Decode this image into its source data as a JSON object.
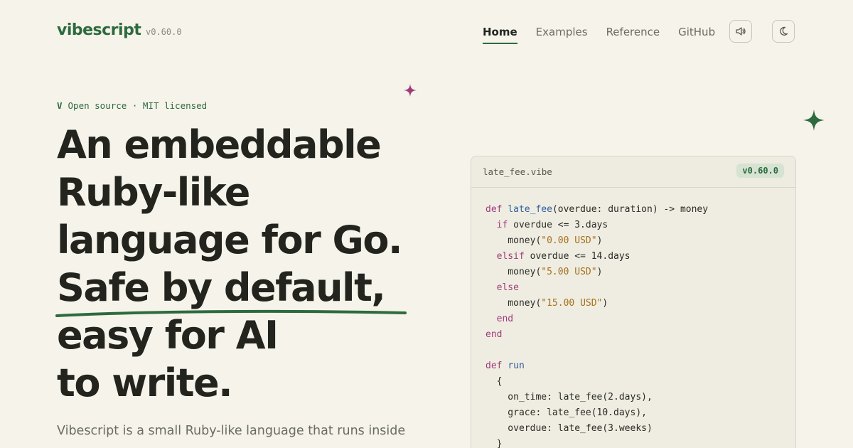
{
  "header": {
    "logo": "vibescript",
    "version": "v0.60.0",
    "nav": [
      {
        "label": "Home",
        "active": true
      },
      {
        "label": "Examples",
        "active": false
      },
      {
        "label": "Reference",
        "active": false
      },
      {
        "label": "GitHub",
        "active": false
      }
    ],
    "sound_icon": "speaker-icon",
    "theme_icon": "moon-icon"
  },
  "hero": {
    "eyebrow_mark": "V",
    "eyebrow_text": "Open source · MIT licensed",
    "headline": [
      "An embeddable",
      "Ruby-like",
      "language for Go.",
      "Safe by default,",
      "easy for AI",
      "to write."
    ],
    "lead": "Vibescript is a small Ruby-like language that runs inside"
  },
  "code_card": {
    "filename": "late_fee.vibe",
    "badge": "v0.60.0",
    "lines": [
      "def late_fee(overdue: duration) -> money",
      "  if overdue <= 3.days",
      "    money(\"0.00 USD\")",
      "  elsif overdue <= 14.days",
      "    money(\"5.00 USD\")",
      "  else",
      "    money(\"15.00 USD\")",
      "  end",
      "end",
      "",
      "def run",
      "  {",
      "    on_time: late_fee(2.days),",
      "    grace: late_fee(10.days),",
      "    overdue: late_fee(3.weeks)",
      "  }"
    ]
  },
  "colors": {
    "accent": "#2d6a3e",
    "background": "#f5f3ea",
    "sparkle_pink": "#a03a7a",
    "sparkle_green": "#2d6a3e"
  }
}
